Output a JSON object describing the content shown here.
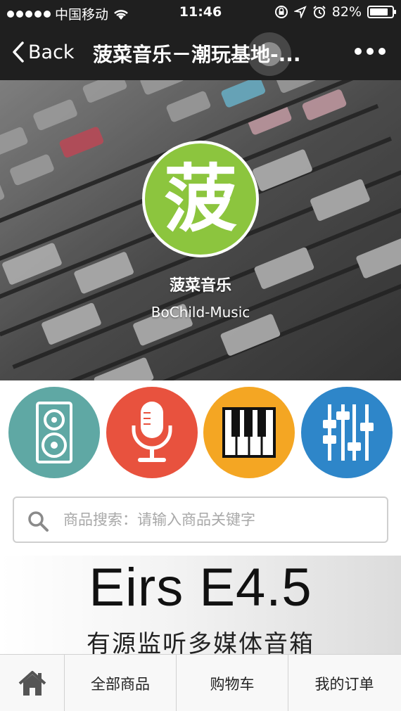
{
  "status_bar": {
    "carrier": "中国移动",
    "time": "11:46",
    "battery_text": "82%",
    "battery_level": 0.82
  },
  "nav": {
    "back_label": "Back",
    "title": "菠菜音乐－潮玩基地-..."
  },
  "hero": {
    "logo_char": "菠",
    "logo_color": "#8cc53e",
    "name_cn": "菠菜音乐",
    "name_en": "BoChild-Music"
  },
  "categories": [
    {
      "icon": "speaker-icon",
      "color": "#5fa8a4"
    },
    {
      "icon": "microphone-icon",
      "color": "#e8523e"
    },
    {
      "icon": "piano-icon",
      "color": "#f4a623"
    },
    {
      "icon": "mixer-sliders-icon",
      "color": "#2e86c9"
    }
  ],
  "search": {
    "placeholder": "商品搜索：请输入商品关键字"
  },
  "banner": {
    "title": "Eirs E4.5",
    "subtitle": "有源监听多媒体音箱"
  },
  "tabbar": {
    "home_icon": "home-icon",
    "tab1": "全部商品",
    "tab2": "购物车",
    "tab3": "我的订单"
  }
}
